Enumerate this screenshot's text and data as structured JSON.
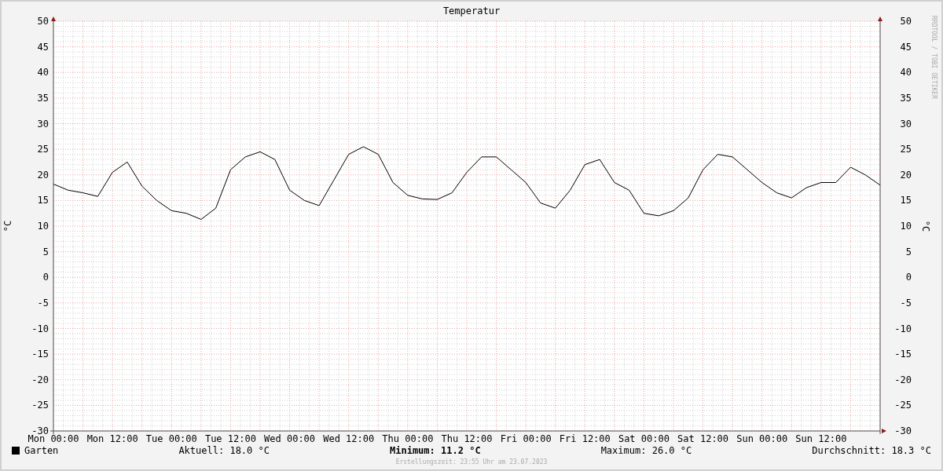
{
  "chart_data": {
    "type": "line",
    "title": "Temperatur",
    "ylabel": "°C",
    "grid": true,
    "ylim": [
      -30,
      50
    ],
    "yticks": [
      -30,
      -25,
      -20,
      -15,
      -10,
      -5,
      0,
      5,
      10,
      15,
      20,
      25,
      30,
      35,
      40,
      45,
      50
    ],
    "categories": [
      "Mon 00:00",
      null,
      null,
      null,
      "Mon 12:00",
      null,
      null,
      null,
      "Tue 00:00",
      null,
      null,
      null,
      "Tue 12:00",
      null,
      null,
      null,
      "Wed 00:00",
      null,
      null,
      null,
      "Wed 12:00",
      null,
      null,
      null,
      "Thu 00:00",
      null,
      null,
      null,
      "Thu 12:00",
      null,
      null,
      null,
      "Fri 00:00",
      null,
      null,
      null,
      "Fri 12:00",
      null,
      null,
      null,
      "Sat 00:00",
      null,
      null,
      null,
      "Sat 12:00",
      null,
      null,
      null,
      "Sun 00:00",
      null,
      null,
      null,
      "Sun 12:00",
      null,
      null,
      null,
      null
    ],
    "series": [
      {
        "name": "Garten",
        "color": "#000000",
        "values": [
          18.2,
          17,
          16.5,
          15.8,
          20.5,
          22.5,
          17.8,
          15,
          13,
          12.5,
          11.3,
          13.5,
          21,
          23.5,
          24.5,
          23,
          17,
          15,
          14,
          19,
          24,
          25.5,
          24,
          18.5,
          16,
          15.3,
          15.2,
          16.5,
          20.5,
          23.5,
          23.5,
          21,
          18.5,
          14.5,
          13.5,
          17,
          22,
          23,
          18.5,
          17,
          12.5,
          12,
          13,
          15.5,
          21,
          24,
          23.5,
          21,
          18.5,
          16.5,
          15.5,
          17.5,
          18.5,
          18.5,
          21.5,
          20,
          18
        ]
      }
    ]
  },
  "right_axis": {
    "label": "°C",
    "ticks": [
      "50",
      "45",
      "40",
      "35",
      "30",
      "25",
      "20",
      "15",
      "10",
      "5",
      "0",
      "-5",
      "-10",
      "-15",
      "-20",
      "-25",
      "-30"
    ]
  },
  "credit": "RRDTOOL / TOBI OETIKER",
  "legend": {
    "stats": [
      {
        "label": "Aktuell:",
        "value": "18.0 °C",
        "bold": false
      },
      {
        "label": "Minimum:",
        "value": "11.2 °C",
        "bold": true
      },
      {
        "label": "Maximum:",
        "value": "26.0 °C",
        "bold": false
      },
      {
        "label": "Durchschnitt:",
        "value": "18.3 °C",
        "bold": false
      }
    ]
  },
  "footer": "Erstellungszeit: 23:55 Uhr am 23.07.2023"
}
